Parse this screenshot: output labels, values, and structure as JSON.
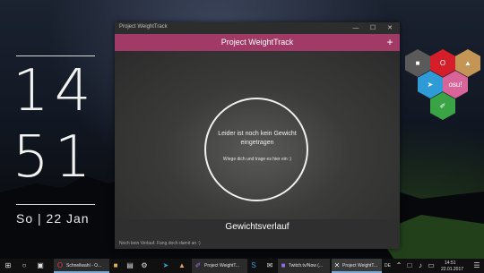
{
  "clock": {
    "hour": "14",
    "minute": "51",
    "date": "So | 22 Jan"
  },
  "window": {
    "titlebar": "Project WeightTrack",
    "minimize": "—",
    "maximize": "☐",
    "close": "✕",
    "app_title": "Project WeightTrack",
    "add_label": "+",
    "empty_message": "Leider ist noch kein Gewicht eingetragen",
    "empty_hint": "Wiege dich und trage es hier ein :)",
    "footer_title": "Gewichtsverlauf",
    "footer_note": "Noch kein Verlauf. Fang doch damit an :)"
  },
  "tiles": [
    {
      "name": "folder",
      "glyph": "■",
      "color": "#5a5a5a"
    },
    {
      "name": "opera",
      "glyph": "O",
      "color": "#d41f2a"
    },
    {
      "name": "gimp",
      "glyph": "▲",
      "color": "#c49555"
    },
    {
      "name": "telegram",
      "glyph": "➤",
      "color": "#2f9bd6"
    },
    {
      "name": "osu",
      "glyph": "osu!",
      "color": "#d8649a"
    },
    {
      "name": "visual-studio",
      "glyph": "✐",
      "color": "#3aa346"
    }
  ],
  "taskbar": {
    "items": [
      {
        "label": "Schnellwahl - O..."
      },
      {
        "label": "Project WeightT..."
      },
      {
        "label": "Twitch.tv/Now (..."
      },
      {
        "label": "Project WeightT..."
      }
    ],
    "language": "DE",
    "time": "14:51",
    "date": "22.01.2017"
  }
}
